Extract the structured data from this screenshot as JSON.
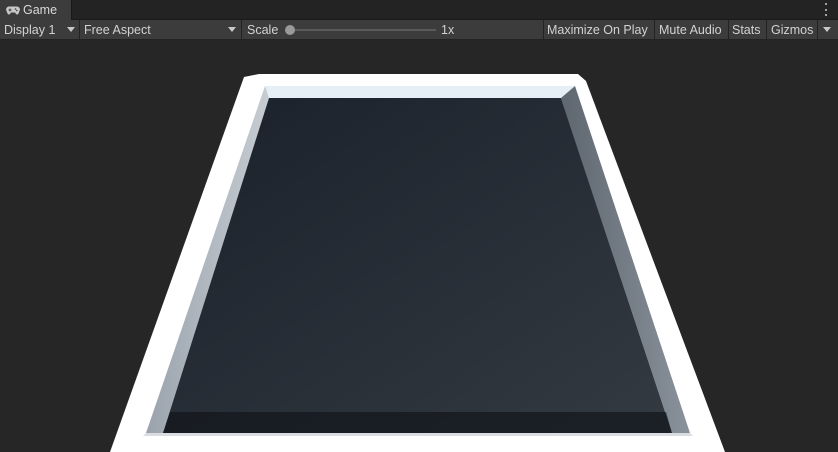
{
  "tab": {
    "label": "Game",
    "icon": "gamepad-icon"
  },
  "toolbar": {
    "display": "Display 1",
    "aspect": "Free Aspect",
    "scale_label": "Scale",
    "scale_value": "1x",
    "scale_slider_fraction": 0.0,
    "maximize_on_play": "Maximize On Play",
    "mute_audio": "Mute Audio",
    "stats": "Stats",
    "gizmos": "Gizmos"
  },
  "colors": {
    "tab_background": "#3c3c3c",
    "toolbar_background": "#3c3c3c",
    "viewport_background": "#262626",
    "tray_rim": "#ffffff",
    "tray_floor": "#1f2530"
  }
}
